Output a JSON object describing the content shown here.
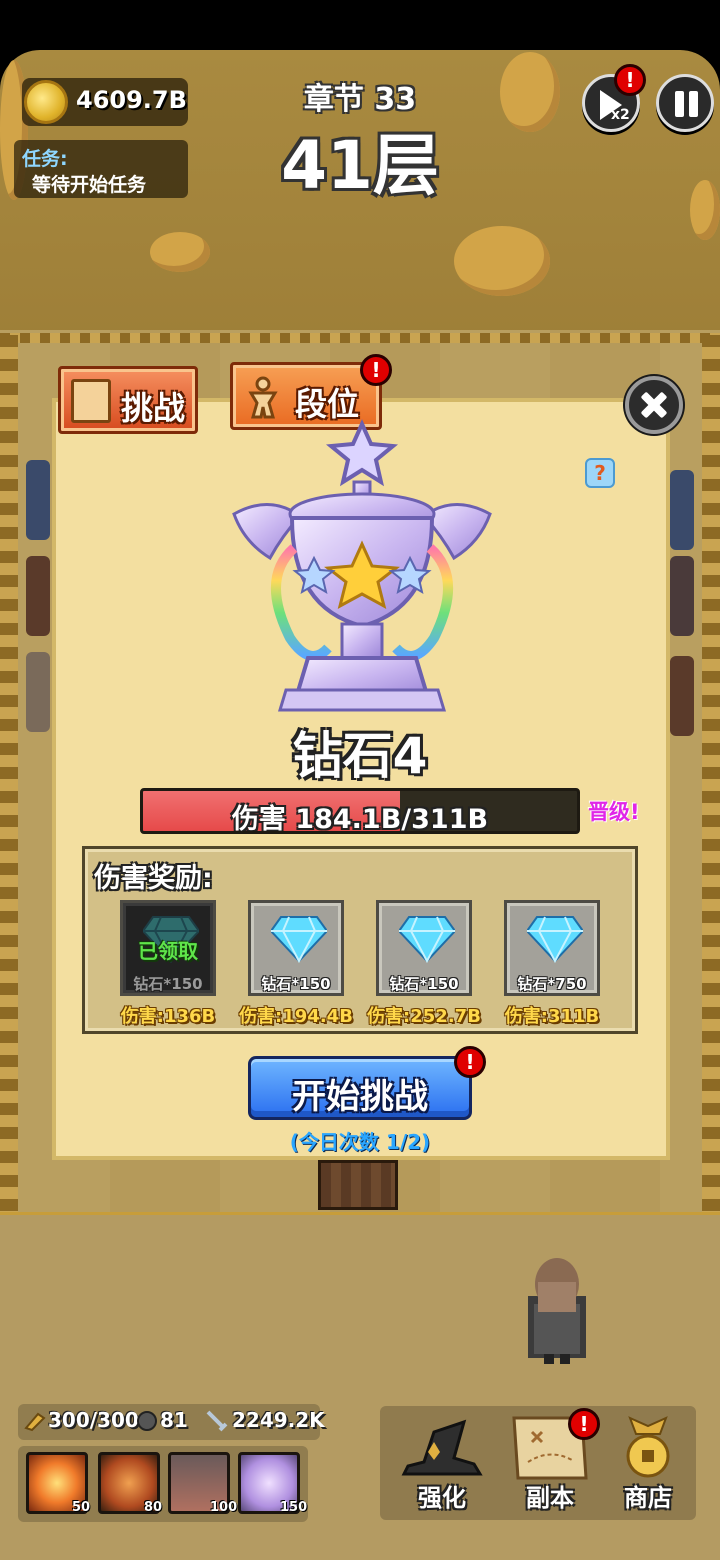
{
  "hud": {
    "coins": "4609.7B",
    "task_label": "任务:",
    "task_text": "等待开始任务",
    "chapter": "章节 33",
    "floor": "41层",
    "speed_label": "x2",
    "speed_alert": "!",
    "icons": [
      "coin-icon",
      "fast-forward-icon",
      "pause-icon"
    ]
  },
  "tabs": [
    {
      "label": "挑战",
      "icon": "scroll-icon",
      "active": false
    },
    {
      "label": "段位",
      "icon": "figure-icon",
      "active": true,
      "alert": "!"
    }
  ],
  "modal": {
    "help": "?",
    "rank_name": "钻石4",
    "damage_text": "伤害 184.1B/311B",
    "damage_progress": 0.592,
    "promote": "晋级!",
    "reward_title": "伤害奖励:",
    "rewards": [
      {
        "item": "钻石*150",
        "requirement": "伤害:136B",
        "claimed": true,
        "claimed_text": "已领取"
      },
      {
        "item": "钻石*150",
        "requirement": "伤害:194.4B",
        "claimed": false
      },
      {
        "item": "钻石*150",
        "requirement": "伤害:252.7B",
        "claimed": false
      },
      {
        "item": "钻石*750",
        "requirement": "伤害:311B",
        "claimed": false
      }
    ],
    "start_button": "开始挑战",
    "start_alert": "!",
    "daily_count": "(今日次数 1/2)"
  },
  "bottom": {
    "stamina": "300/300",
    "keys": "81",
    "attack": "2249.2K",
    "skills": [
      {
        "icon": "explosion-skill-icon",
        "cost": "50"
      },
      {
        "icon": "fire-beast-skill-icon",
        "cost": "80"
      },
      {
        "icon": "spikes-skill-icon",
        "cost": "100"
      },
      {
        "icon": "angel-skill-icon",
        "cost": "150"
      }
    ],
    "menu": [
      {
        "label": "强化",
        "icon": "wizard-hat-icon"
      },
      {
        "label": "副本",
        "icon": "map-scroll-icon",
        "alert": "!"
      },
      {
        "label": "商店",
        "icon": "shop-medal-icon"
      }
    ]
  },
  "colors": {
    "gem": "#5fdcff",
    "modal_bg": "#f3dfa0",
    "damage_fill": "#e64a4a",
    "promote": "#e026e8",
    "claimed_text": "#5fe54a"
  }
}
